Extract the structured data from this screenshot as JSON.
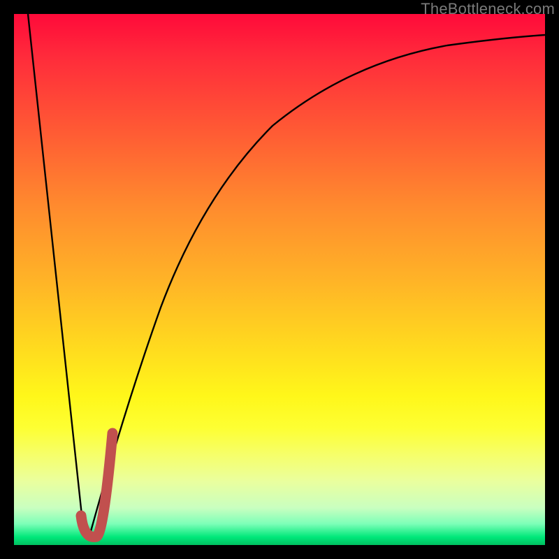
{
  "watermark": {
    "text": "TheBottleneck.com"
  },
  "colors": {
    "frame": "#000000",
    "curve": "#000000",
    "marker": "#c1504e",
    "gradient_top": "#ff0a3a",
    "gradient_bottom": "#00c060"
  },
  "chart_data": {
    "type": "line",
    "title": "",
    "xlabel": "",
    "ylabel": "",
    "xlim": [
      0,
      100
    ],
    "ylim": [
      0,
      100
    ],
    "grid": false,
    "legend": false,
    "series": [
      {
        "name": "left-branch",
        "x": [
          2.6,
          13.2
        ],
        "y": [
          100,
          2
        ]
      },
      {
        "name": "right-branch",
        "x": [
          13.2,
          16,
          20,
          24,
          28,
          32,
          38,
          45,
          55,
          65,
          75,
          85,
          95,
          100
        ],
        "y": [
          2,
          20,
          40,
          53,
          62,
          69,
          76,
          82,
          87,
          90.5,
          92.8,
          94.2,
          95.2,
          95.6
        ]
      }
    ],
    "marker": {
      "name": "highlight-J",
      "points": [
        {
          "x": 13.2,
          "y": 4
        },
        {
          "x": 15.0,
          "y": 3
        },
        {
          "x": 18.5,
          "y": 20
        }
      ]
    }
  }
}
